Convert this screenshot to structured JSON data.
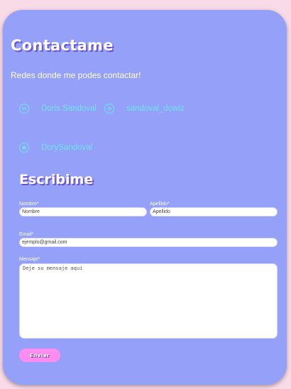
{
  "header": {
    "title": "Contactame",
    "subtitle": "Redes donde me podes contactar!"
  },
  "social": {
    "linkedin": {
      "icon": "linkedin-icon",
      "glyph": "in",
      "label": "Doris Sandoval"
    },
    "instagram": {
      "icon": "instagram-icon",
      "glyph": "◎",
      "label": "sandoval_dowiz"
    },
    "github": {
      "icon": "github-icon",
      "glyph": "◉",
      "label": "DorySandoval"
    }
  },
  "form": {
    "heading": "Escribime",
    "nombre": {
      "label": "Nombre*",
      "placeholder": "Nombre"
    },
    "apellido": {
      "label": "Apellido*",
      "placeholder": "Apellido"
    },
    "email": {
      "label": "Email*",
      "placeholder": "ejemplo@gmail.com"
    },
    "mensaje": {
      "label": "Mensaje*",
      "placeholder": "Deje su mensaje aqui"
    },
    "submit_label": "Enviar"
  },
  "colors": {
    "card": "#95a0f8",
    "background": "#f9dbe8",
    "accent_cyan": "#6fe3ec",
    "button": "#ff8cf0",
    "title_shadow": "#6a54d6"
  }
}
